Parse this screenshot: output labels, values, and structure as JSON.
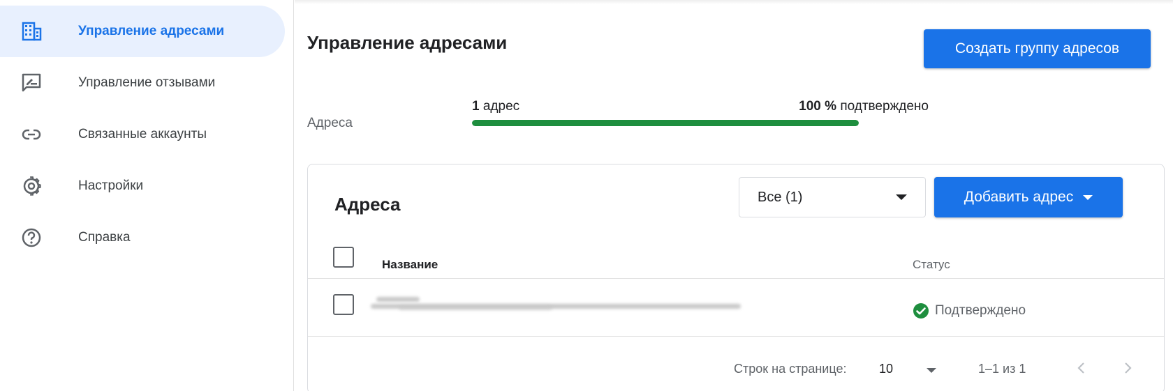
{
  "sidebar": {
    "items": [
      {
        "label": "Управление адресами",
        "icon": "building-grid-icon",
        "active": true
      },
      {
        "label": "Управление отзывами",
        "icon": "review-edit-icon",
        "active": false
      },
      {
        "label": "Связанные аккаунты",
        "icon": "link-icon",
        "active": false
      },
      {
        "label": "Настройки",
        "icon": "gear-icon",
        "active": false
      },
      {
        "label": "Справка",
        "icon": "help-circle-icon",
        "active": false
      }
    ]
  },
  "header": {
    "title": "Управление адресами",
    "create_group_label": "Создать группу адресов"
  },
  "progress": {
    "label": "Адреса",
    "count_number": "1",
    "count_text": "адрес",
    "percent_number": "100 %",
    "percent_text": "подтверждено",
    "fraction": 1.0
  },
  "card": {
    "title": "Адреса",
    "filter_value": "Все (1)",
    "add_label": "Добавить адрес",
    "columns": {
      "name": "Название",
      "status": "Статус"
    },
    "rows": [
      {
        "name": "",
        "status": "Подтверждено"
      }
    ],
    "footer": {
      "rows_per_page_label": "Строк на странице:",
      "rows_per_page_value": "10",
      "range": "1–1 из 1"
    }
  },
  "colors": {
    "accent": "#1a73e8",
    "active_bg": "#e8f0fe",
    "success": "#1e8e3e"
  }
}
